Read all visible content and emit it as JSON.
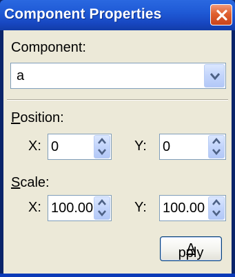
{
  "window": {
    "title": "Component Properties",
    "close_icon": "close-icon"
  },
  "component": {
    "label": "Component:",
    "value": "a",
    "dropdown_icon": "chevron-down-icon"
  },
  "position": {
    "label_mnemonic": "P",
    "label_rest": "osition:",
    "x_label": "X:",
    "x_value": "0",
    "y_label": "Y:",
    "y_value": "0"
  },
  "scale": {
    "label_mnemonic": "S",
    "label_rest": "cale:",
    "x_label": "X:",
    "x_value": "100.00",
    "y_label": "Y:",
    "y_value": "100.00"
  },
  "apply_button": {
    "mnemonic": "A",
    "rest": "pply"
  },
  "colors": {
    "titlebar": "#1f5ad6",
    "client_bg": "#ece9d8",
    "close_button": "#e0602f",
    "field_border": "#7f9db9"
  }
}
